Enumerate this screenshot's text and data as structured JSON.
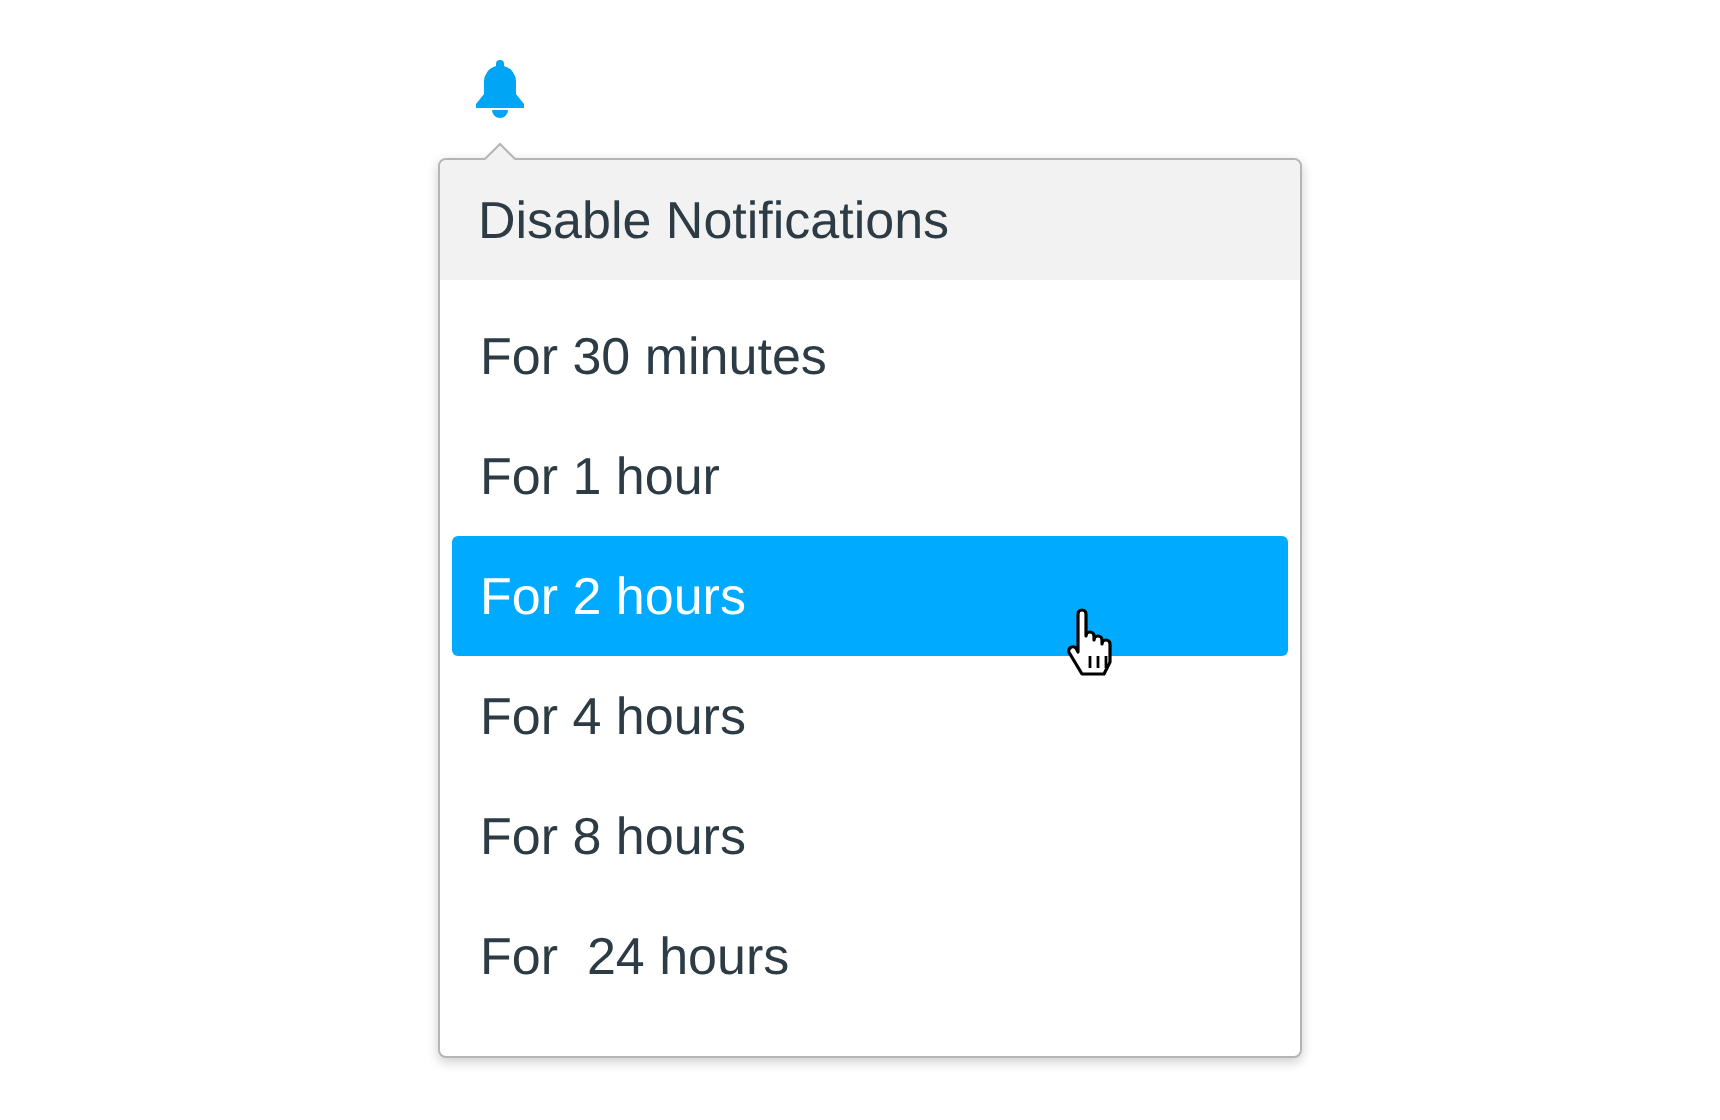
{
  "menu": {
    "title": "Disable Notifications",
    "items": [
      {
        "label": "For 30 minutes",
        "selected": false
      },
      {
        "label": "For 1 hour",
        "selected": false
      },
      {
        "label": "For 2 hours",
        "selected": true
      },
      {
        "label": "For 4 hours",
        "selected": false
      },
      {
        "label": "For 8 hours",
        "selected": false
      },
      {
        "label": "For  24 hours",
        "selected": false
      }
    ]
  }
}
